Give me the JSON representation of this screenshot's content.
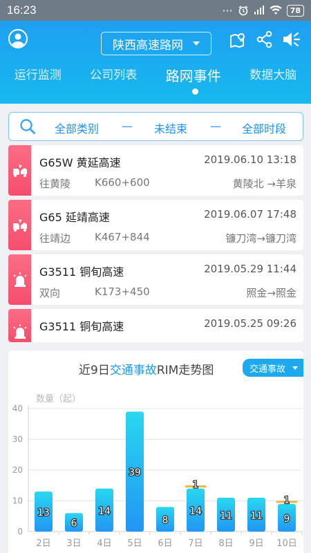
{
  "status": {
    "time": "16:23",
    "battery": "78"
  },
  "header": {
    "region": "陕西高速路网"
  },
  "tabs": [
    "运行监测",
    "公司列表",
    "路网事件",
    "数据大脑"
  ],
  "filter": {
    "category": "全部类别",
    "sep1": "—",
    "state": "未结束",
    "sep2": "—",
    "period": "全部时段"
  },
  "events": [
    {
      "icon": "collision-icon",
      "road": "G65W 黄延高速",
      "time": "2019.06.10 13:18",
      "direction": "往黄陵",
      "km": "K660+600",
      "segment": "黄陵北 →羊泉"
    },
    {
      "icon": "collision-icon",
      "road": "G65 延靖高速",
      "time": "2019.06.07 17:48",
      "direction": "往靖边",
      "km": "K467+844",
      "segment": "镰刀湾→镰刀湾"
    },
    {
      "icon": "siren-icon",
      "road": "G3511 铜旬高速",
      "time": "2019.05.29 11:44",
      "direction": "双向",
      "km": "K173+450",
      "segment": "照金→照金"
    },
    {
      "icon": "siren-icon",
      "road": "G3511 铜旬高速",
      "time": "2019.05.25 09:26",
      "direction": "",
      "km": "",
      "segment": ""
    }
  ],
  "chart_title": {
    "pre": "近9日",
    "highlight": "交通事故",
    "post": "RIM走势图"
  },
  "chart_select": "交通事故",
  "colors": {
    "accent": "#1c9be8",
    "danger": "#f5566f",
    "bar_top": "#2ad7f0",
    "bar_bottom": "#2196f3",
    "marker": "#f5b342"
  },
  "chart_data": {
    "type": "bar",
    "ylabel": "数量（起）",
    "ylim": [
      0,
      40
    ],
    "yticks": [
      0,
      10,
      20,
      30,
      40
    ],
    "grid": true,
    "categories": [
      "2日",
      "3日",
      "4日",
      "5日",
      "6日",
      "7日",
      "8日",
      "9日",
      "10日"
    ],
    "values": [
      13,
      6,
      14,
      39,
      8,
      14,
      11,
      11,
      9
    ],
    "markers": [
      {
        "category": "7日",
        "value": 1
      },
      {
        "category": "10日",
        "value": 1
      }
    ]
  }
}
